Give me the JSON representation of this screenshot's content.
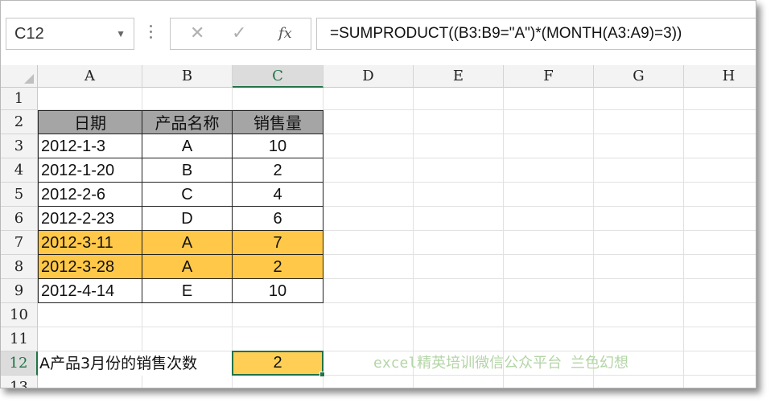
{
  "name_box": {
    "value": "C12"
  },
  "formula_bar": {
    "cancel_icon": "✕",
    "enter_icon": "✓",
    "fx_label": "fx",
    "formula": "=SUMPRODUCT((B3:B9=\"A\")*(MONTH(A3:A9)=3))"
  },
  "columns": [
    "A",
    "B",
    "C",
    "D",
    "E",
    "F",
    "G",
    "H"
  ],
  "rows": [
    "1",
    "2",
    "3",
    "4",
    "5",
    "6",
    "7",
    "8",
    "9",
    "10",
    "11",
    "12",
    "13"
  ],
  "table": {
    "headers": [
      "日期",
      "产品名称",
      "销售量"
    ],
    "rows": [
      [
        "2012-1-3",
        "A",
        "10"
      ],
      [
        "2012-1-20",
        "B",
        "2"
      ],
      [
        "2012-2-6",
        "C",
        "4"
      ],
      [
        "2012-2-23",
        "D",
        "6"
      ],
      [
        "2012-3-11",
        "A",
        "7"
      ],
      [
        "2012-3-28",
        "A",
        "2"
      ],
      [
        "2012-4-14",
        "E",
        "10"
      ]
    ],
    "highlighted_rows": [
      4,
      5
    ]
  },
  "summary": {
    "label": "A产品3月份的销售次数",
    "value": "2"
  },
  "watermark": "excel精英培训微信公众平台 兰色幻想",
  "colors": {
    "header_fill": "#a5a5a5",
    "highlight_fill": "#ffc848",
    "selection_green": "#217346",
    "watermark_green": "#b3d5a6"
  },
  "selected_cell": "C12"
}
